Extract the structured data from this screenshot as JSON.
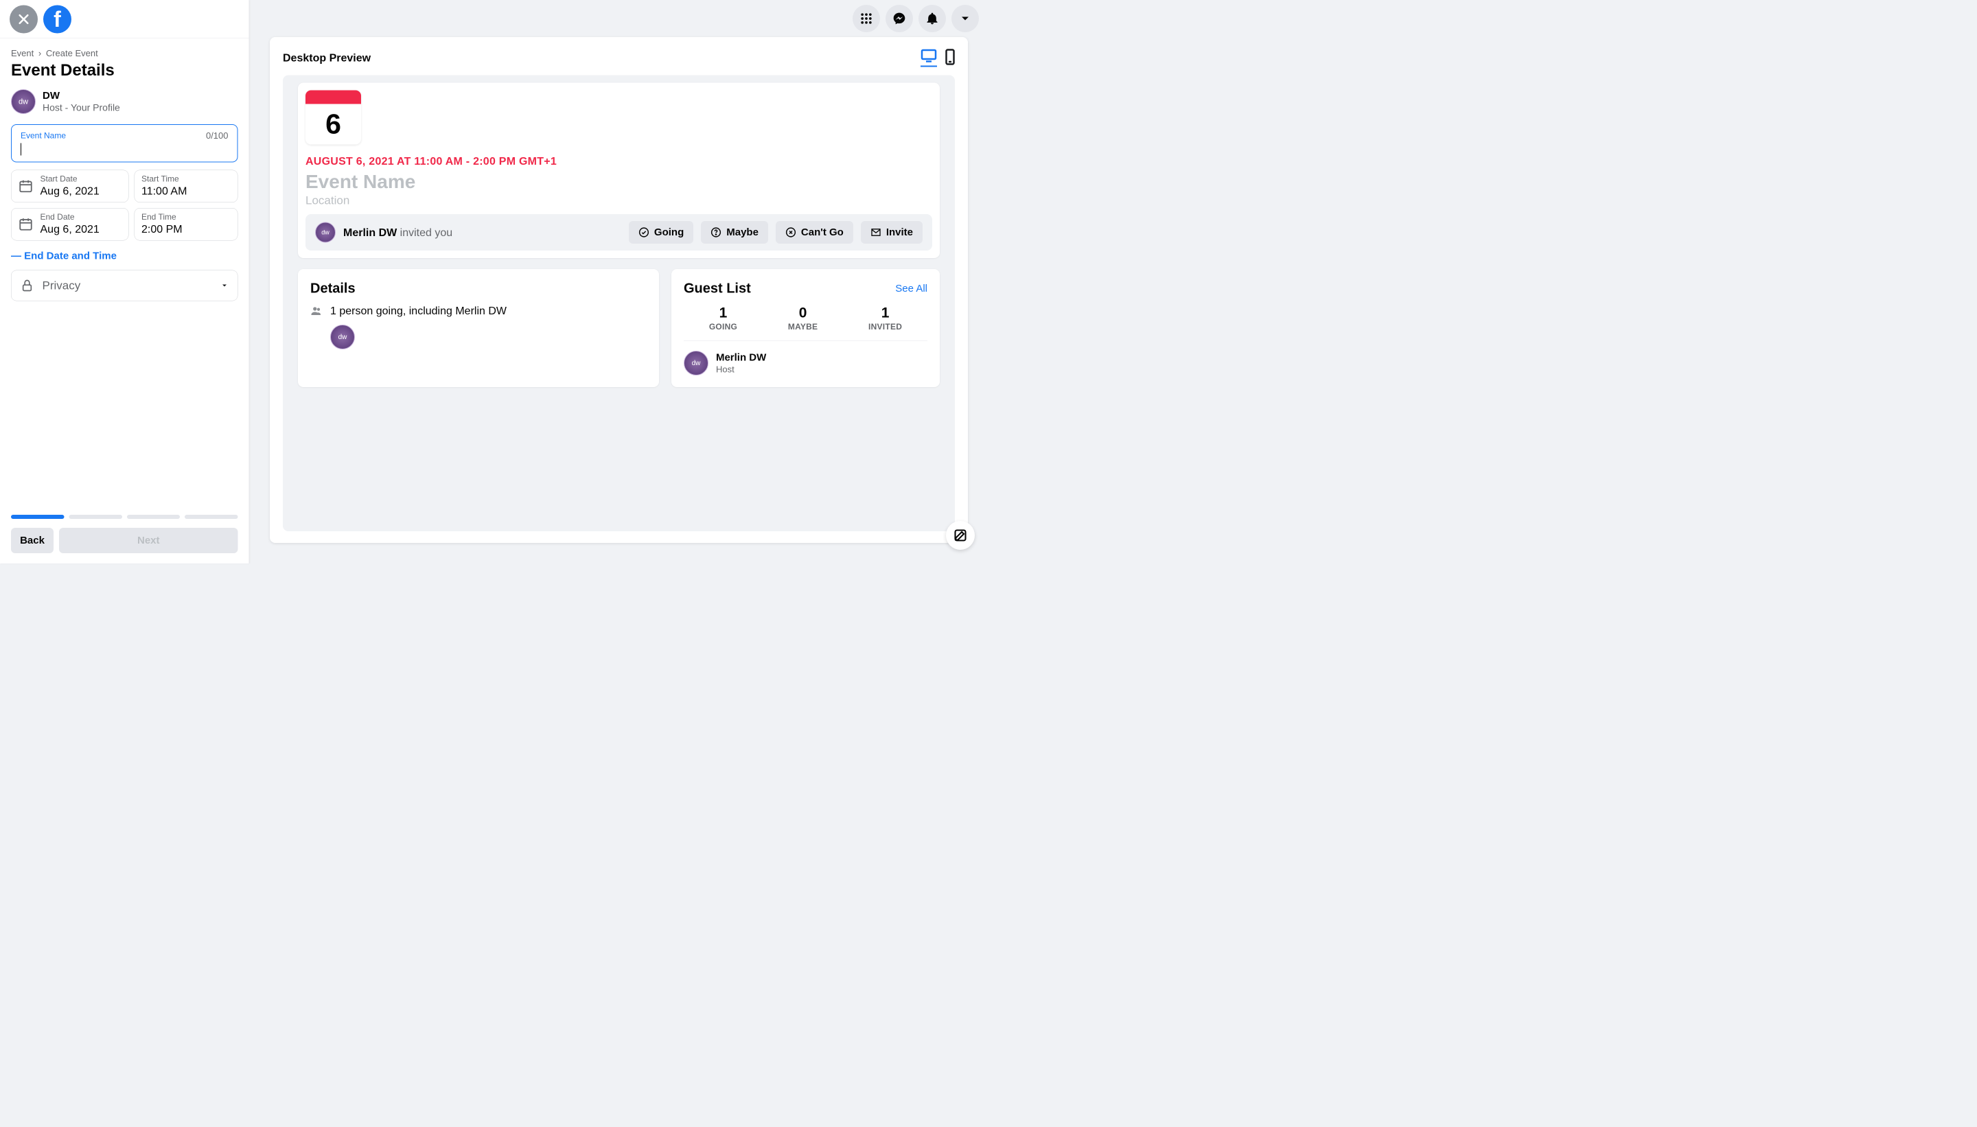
{
  "breadcrumb": {
    "root": "Event",
    "current": "Create Event"
  },
  "page_title": "Event Details",
  "host": {
    "name": "DW",
    "subtitle": "Host - Your Profile",
    "avatar_text": "dw"
  },
  "event_name_input": {
    "label": "Event Name",
    "count": "0/100",
    "value": ""
  },
  "start_date": {
    "label": "Start Date",
    "value": "Aug 6, 2021"
  },
  "start_time": {
    "label": "Start Time",
    "value": "11:00 AM"
  },
  "end_date": {
    "label": "End Date",
    "value": "Aug 6, 2021"
  },
  "end_time": {
    "label": "End Time",
    "value": "2:00 PM"
  },
  "end_toggle": "— End Date and Time",
  "privacy": {
    "label": "Privacy"
  },
  "buttons": {
    "back": "Back",
    "next": "Next"
  },
  "preview": {
    "title": "Desktop Preview",
    "calendar_day": "6",
    "datetime": "AUGUST 6, 2021 AT 11:00 AM - 2:00 PM GMT+1",
    "name_placeholder": "Event Name",
    "location_placeholder": "Location",
    "inviter_name": "Merlin DW",
    "inviter_suffix": " invited you",
    "rsvp": {
      "going": "Going",
      "maybe": "Maybe",
      "cant": "Can't Go",
      "invite": "Invite"
    },
    "details": {
      "title": "Details",
      "going_text": "1 person going, including Merlin DW"
    },
    "guest_list": {
      "title": "Guest List",
      "see_all": "See All",
      "stats": [
        {
          "num": "1",
          "lbl": "GOING"
        },
        {
          "num": "0",
          "lbl": "MAYBE"
        },
        {
          "num": "1",
          "lbl": "INVITED"
        }
      ],
      "guest": {
        "name": "Merlin DW",
        "role": "Host",
        "avatar_text": "dw"
      }
    }
  }
}
